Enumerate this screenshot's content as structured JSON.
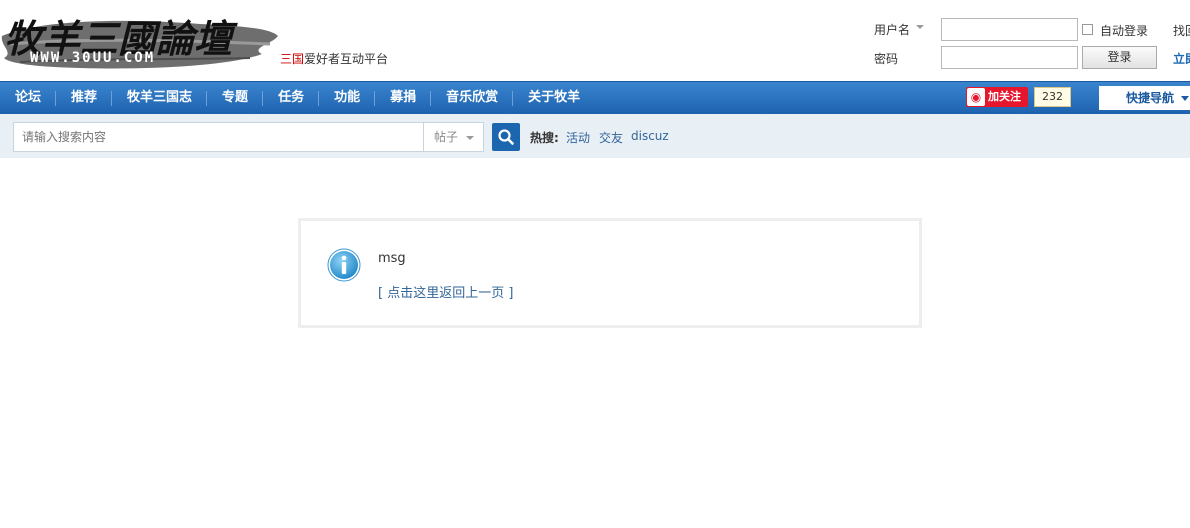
{
  "logo": {
    "text": "牧羊三國論壇",
    "url_text": "WWW.30UU.COM"
  },
  "tagline": {
    "highlight": "三国",
    "rest": "爱好者互动平台"
  },
  "login": {
    "username_label": "用户名",
    "password_label": "密码",
    "username_value": "",
    "password_value": "",
    "autologin_label": "自动登录",
    "login_button": "登录",
    "forgot_link": "找回",
    "register_link": "立即"
  },
  "nav": {
    "items": [
      "论坛",
      "推荐",
      "牧羊三国志",
      "专题",
      "任务",
      "功能",
      "募捐",
      "音乐欣赏",
      "关于牧羊"
    ]
  },
  "weibo": {
    "follow_label": "加关注",
    "count": "232"
  },
  "quicknav": {
    "label": "快捷导航"
  },
  "search": {
    "placeholder": "请输入搜索内容",
    "type_label": "帖子",
    "hot_label": "热搜:",
    "hot_links": [
      "活动",
      "交友",
      "discuz"
    ]
  },
  "message": {
    "text": "msg",
    "back_link": "[ 点击这里返回上一页 ]"
  },
  "colors": {
    "nav_blue": "#1e62ae",
    "link_blue": "#336699",
    "weibo_red": "#e6162d"
  }
}
